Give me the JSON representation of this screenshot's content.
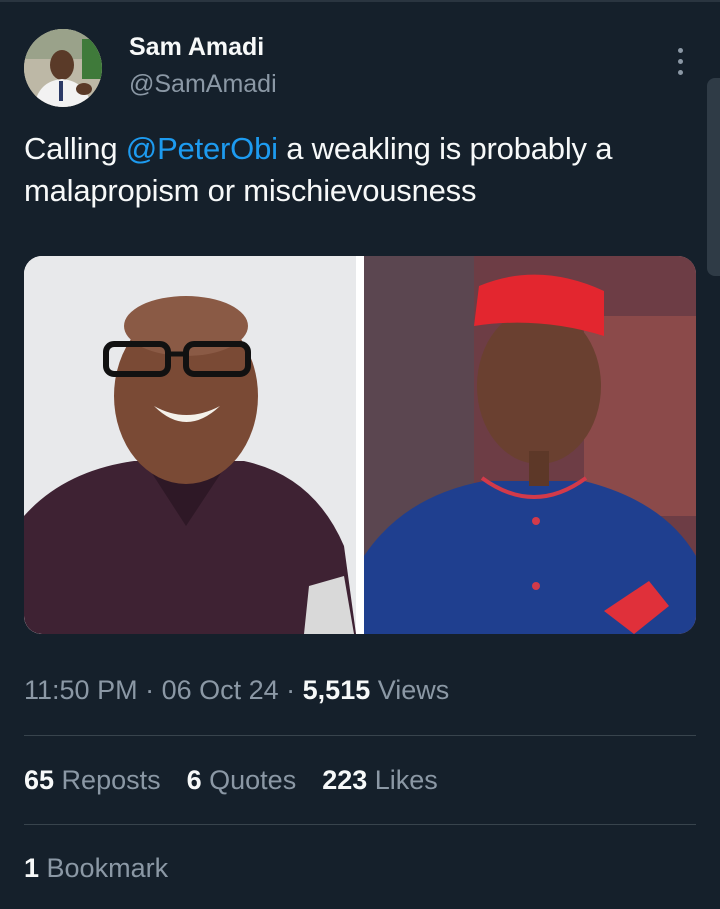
{
  "author": {
    "name": "Sam Amadi",
    "handle": "@SamAmadi"
  },
  "tweet": {
    "text_before": "Calling ",
    "mention": "@PeterObi",
    "text_after": " a weakling is probably a malapropism or mischievousness"
  },
  "meta": {
    "time": "11:50 PM",
    "sep1": " · ",
    "date": "06 Oct 24",
    "sep2": " · ",
    "views_count": "5,515",
    "views_label": " Views"
  },
  "stats": {
    "reposts_count": "65",
    "reposts_label": " Reposts",
    "quotes_count": "6",
    "quotes_label": " Quotes",
    "likes_count": "223",
    "likes_label": " Likes"
  },
  "bookmarks": {
    "count": "1",
    "label": " Bookmark"
  },
  "colors": {
    "background": "#15202b",
    "link": "#1d9bf0",
    "secondary_text": "#8b98a5"
  }
}
